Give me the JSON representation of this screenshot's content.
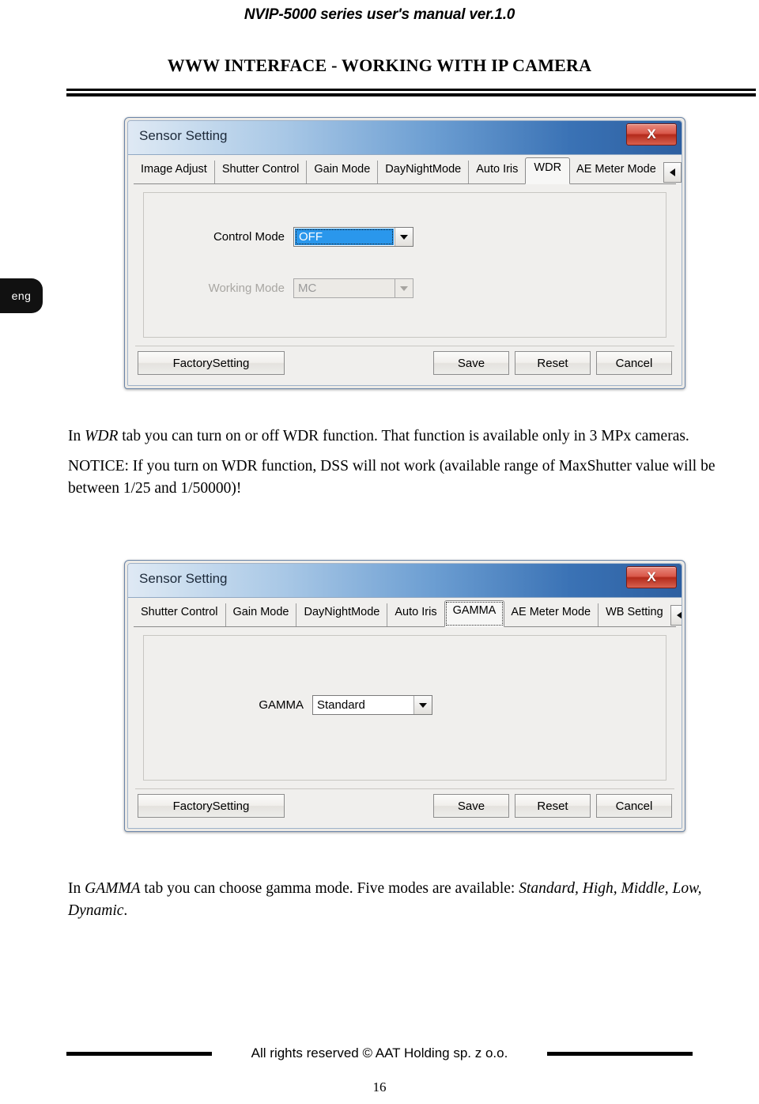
{
  "page": {
    "running_head": "NVIP-5000 series user's manual ver.1.0",
    "section_title": "WWW INTERFACE - WORKING WITH IP CAMERA",
    "language_tab": "eng",
    "footer": "All rights reserved © AAT Holding sp. z o.o.",
    "page_number": "16"
  },
  "dialog_wdr": {
    "title": "Sensor Setting",
    "close_label": "X",
    "tabs": [
      {
        "label": "Image Adjust",
        "active": false
      },
      {
        "label": "Shutter Control",
        "active": false
      },
      {
        "label": "Gain Mode",
        "active": false
      },
      {
        "label": "DayNightMode",
        "active": false
      },
      {
        "label": "Auto Iris",
        "active": false
      },
      {
        "label": "WDR",
        "active": true
      },
      {
        "label": "AE Meter Mode",
        "active": false
      }
    ],
    "scroll_prev": "◀",
    "scroll_next": "▶",
    "fields": [
      {
        "label": "Control Mode",
        "value": "OFF",
        "state": "selected"
      },
      {
        "label": "Working Mode",
        "value": "MC",
        "state": "disabled"
      }
    ],
    "buttons": {
      "factory": "FactorySetting",
      "save": "Save",
      "reset": "Reset",
      "cancel": "Cancel"
    }
  },
  "paragraph_wdr_1_html": "In <i>WDR</i> tab you can turn on or off WDR function. That function is available only in 3 MPx cameras.",
  "paragraph_wdr_2_html": "NOTICE: If you turn on WDR function, DSS will not work (available range of MaxShutter value will be between 1/25 and 1/50000)!",
  "dialog_gamma": {
    "title": "Sensor Setting",
    "close_label": "X",
    "tabs": [
      {
        "label": "Shutter Control",
        "active": false
      },
      {
        "label": "Gain Mode",
        "active": false
      },
      {
        "label": "DayNightMode",
        "active": false
      },
      {
        "label": "Auto Iris",
        "active": false
      },
      {
        "label": "GAMMA",
        "active": true
      },
      {
        "label": "AE Meter Mode",
        "active": false
      },
      {
        "label": "WB Setting",
        "active": false
      }
    ],
    "scroll_prev": "◀",
    "scroll_next": "▶",
    "fields": [
      {
        "label": "GAMMA",
        "value": "Standard",
        "state": "normal"
      }
    ],
    "buttons": {
      "factory": "FactorySetting",
      "save": "Save",
      "reset": "Reset",
      "cancel": "Cancel"
    }
  },
  "paragraph_gamma_html": "In <i>GAMMA</i> tab you can choose gamma mode. Five modes are available: <i>Standard, High, Middle, Low, Dynamic</i>.",
  "colors": {
    "title_bar_start": "#dfe9f4",
    "title_bar_end": "#2d5fa0",
    "close_button": "#b32a1b",
    "selection_blue": "#2a97ec",
    "dialog_face": "#f0efed",
    "frame_border": "#6b85a8"
  }
}
